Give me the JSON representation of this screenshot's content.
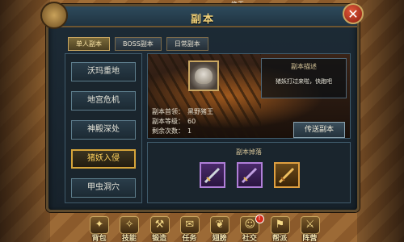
{
  "scene": {
    "top_name": "绝王"
  },
  "dialog": {
    "title": "副本"
  },
  "tabs": [
    {
      "label": "单人副本",
      "active": true
    },
    {
      "label": "BOSS副本",
      "active": false
    },
    {
      "label": "日常副本",
      "active": false
    }
  ],
  "dungeons": [
    {
      "label": "沃玛重地",
      "selected": false
    },
    {
      "label": "地宫危机",
      "selected": false
    },
    {
      "label": "神殿深处",
      "selected": false
    },
    {
      "label": "猪妖入侵",
      "selected": true
    },
    {
      "label": "甲虫洞穴",
      "selected": false
    }
  ],
  "detail": {
    "description_title": "副本描述",
    "description_text": "猪妖打过来啦，快跑吧",
    "stats": [
      {
        "key": "副本首领：",
        "value": "黑野猪王"
      },
      {
        "key": "副本等级：",
        "value": "60"
      },
      {
        "key": "剩余次数：",
        "value": "1"
      }
    ],
    "teleport_label": "传送副本",
    "portrait_icon": "boar-king-portrait-icon"
  },
  "drops": {
    "title": "副本掉落",
    "items": [
      {
        "icon": "sword-icon",
        "rarity": "purple"
      },
      {
        "icon": "sword-icon",
        "rarity": "purple"
      },
      {
        "icon": "sword-icon",
        "rarity": "orange"
      }
    ]
  },
  "bottom_bar": [
    {
      "label": "背包",
      "icon": "bag-icon",
      "badge": ""
    },
    {
      "label": "技能",
      "icon": "skill-icon",
      "badge": ""
    },
    {
      "label": "锻造",
      "icon": "forge-icon",
      "badge": ""
    },
    {
      "label": "任务",
      "icon": "quest-icon",
      "badge": ""
    },
    {
      "label": "翅膀",
      "icon": "wing-icon",
      "badge": ""
    },
    {
      "label": "社交",
      "icon": "social-icon",
      "badge": "!"
    },
    {
      "label": "帮派",
      "icon": "guild-icon",
      "badge": ""
    },
    {
      "label": "阵营",
      "icon": "camp-icon",
      "badge": ""
    }
  ],
  "colors": {
    "accent_gold": "#d6a53a",
    "purple_rarity": "#b07fd8",
    "orange_rarity": "#e0a040"
  }
}
